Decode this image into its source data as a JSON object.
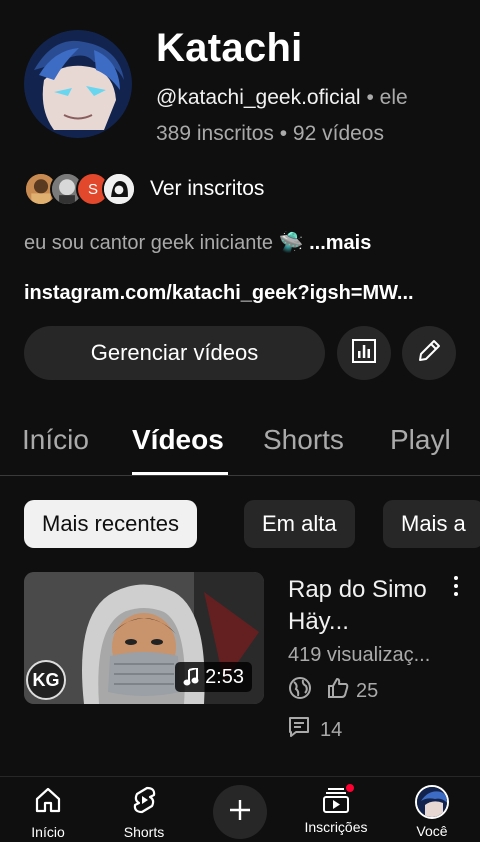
{
  "channel": {
    "name": "Katachi",
    "handle": "@katachi_geek.oficial",
    "separator": "•",
    "pronoun": "ele",
    "stats": "389 inscritos • 92 vídeos",
    "see_subscribers": "Ver inscritos",
    "description": "eu sou cantor geek iniciante 🛸",
    "more": "...mais",
    "link": "instagram.com/katachi_geek?igsh=MW...",
    "subscriber_avatars": [
      {
        "letter": "",
        "color": "#a0653a"
      },
      {
        "letter": "",
        "color": "#6b6b6b"
      },
      {
        "letter": "S",
        "color": "#e2482c"
      },
      {
        "letter": "",
        "color": "#e9e9e9"
      }
    ]
  },
  "actions": {
    "manage_label": "Gerenciar vídeos",
    "stats_icon": "analytics-icon",
    "edit_icon": "pencil-icon"
  },
  "tabs": [
    {
      "label": "Início",
      "active": false
    },
    {
      "label": "Vídeos",
      "active": true
    },
    {
      "label": "Shorts",
      "active": false
    },
    {
      "label": "Playl",
      "active": false
    }
  ],
  "chips": [
    {
      "label": "Mais recentes",
      "selected": true
    },
    {
      "label": "Em alta",
      "selected": false
    },
    {
      "label": "Mais a",
      "selected": false
    }
  ],
  "video": {
    "title": "Rap do Simo Häy...",
    "views": "419 visualizaç...",
    "duration": "2:53",
    "badge": "KG",
    "likes": "25",
    "comments": "14"
  },
  "nav": [
    {
      "label": "Início",
      "icon": "home-icon"
    },
    {
      "label": "Shorts",
      "icon": "shorts-icon"
    },
    {
      "label": "",
      "icon": "plus-icon"
    },
    {
      "label": "Inscrições",
      "icon": "subscriptions-icon"
    },
    {
      "label": "Você",
      "icon": "avatar-icon"
    }
  ],
  "colors": {
    "background": "#0f0f0f",
    "surface": "#272727",
    "text_secondary": "#aaaaaa",
    "notification": "#ff0033"
  }
}
